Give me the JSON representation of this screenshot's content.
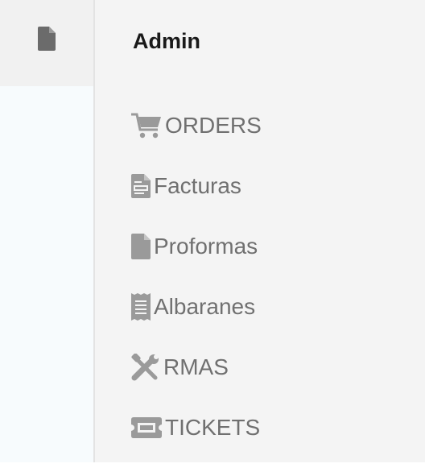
{
  "rail": {
    "active_icon": "document-icon"
  },
  "panel": {
    "title": "Admin",
    "items": [
      {
        "label": "ORDERS",
        "icon": "cart-icon"
      },
      {
        "label": "Facturas",
        "icon": "invoice-icon"
      },
      {
        "label": "Proformas",
        "icon": "document-icon"
      },
      {
        "label": "Albaranes",
        "icon": "receipt-icon"
      },
      {
        "label": "RMAS",
        "icon": "tools-icon"
      },
      {
        "label": "TICKETS",
        "icon": "ticket-icon"
      }
    ]
  },
  "colors": {
    "rail_bg": "#f7fbfd",
    "rail_active_bg": "#f1f1f1",
    "panel_bg": "#f4f4f4",
    "text_muted": "#707070",
    "text_title": "#1a1a1a",
    "icon_gray": "#9a9a9a"
  }
}
